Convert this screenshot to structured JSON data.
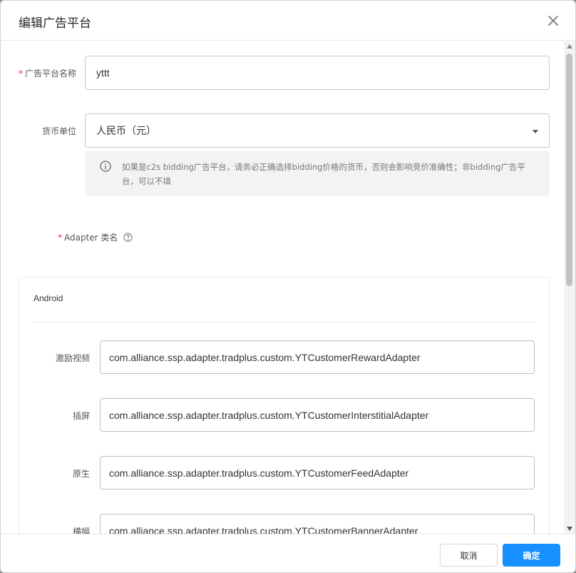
{
  "modal": {
    "title": "编辑广告平台"
  },
  "form": {
    "platform_name": {
      "label": "广告平台名称",
      "value": "yttt"
    },
    "currency": {
      "label": "货币单位",
      "value": "人民币（元）",
      "info": "如果是c2s bidding广告平台，请务必正确选择bidding价格的货币，否则会影响竞价准确性；非bidding广告平台，可以不填"
    },
    "adapter": {
      "label": "Adapter 类名"
    }
  },
  "android": {
    "title": "Android",
    "rows": [
      {
        "label": "激励视频",
        "value": "com.alliance.ssp.adapter.tradplus.custom.YTCustomerRewardAdapter"
      },
      {
        "label": "插屏",
        "value": "com.alliance.ssp.adapter.tradplus.custom.YTCustomerInterstitialAdapter"
      },
      {
        "label": "原生",
        "value": "com.alliance.ssp.adapter.tradplus.custom.YTCustomerFeedAdapter"
      },
      {
        "label": "横幅",
        "value": "com.alliance.ssp.adapter.tradplus.custom.YTCustomerBannerAdapter"
      }
    ]
  },
  "footer": {
    "cancel_label": "取消",
    "ok_label": "确定"
  },
  "icons": {
    "close": "close-icon",
    "info": "info-circle-icon",
    "help": "question-circle-icon",
    "select": "caret-down-icon"
  },
  "colors": {
    "primary": "#1890ff",
    "required": "#f5222d"
  }
}
